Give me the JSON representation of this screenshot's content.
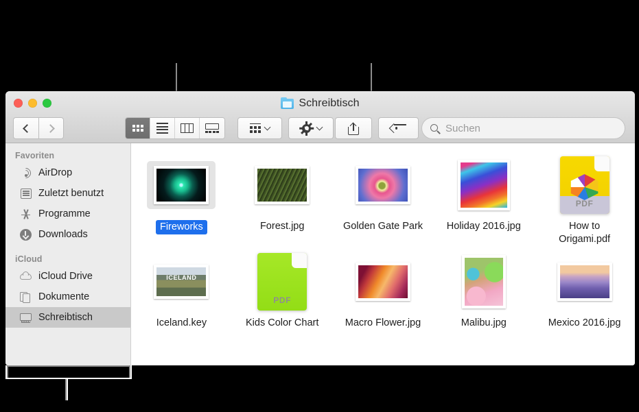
{
  "window": {
    "title": "Schreibtisch",
    "title_icon": "folder-icon",
    "traffic_lights": [
      "close-button",
      "minimize-button",
      "zoom-button"
    ]
  },
  "toolbar": {
    "back_label": "",
    "forward_label": "",
    "back_icon": "chevron-left-icon",
    "forward_icon": "chevron-right-icon",
    "view_buttons": [
      {
        "name": "icon-view",
        "icon": "grid-icon",
        "active": true
      },
      {
        "name": "list-view",
        "icon": "list-icon",
        "active": false
      },
      {
        "name": "column-view",
        "icon": "columns-icon",
        "active": false
      },
      {
        "name": "gallery-view",
        "icon": "gallery-icon",
        "active": false
      }
    ],
    "arrange_button": {
      "name": "arrange-by",
      "icon": "arrange-icon",
      "chevron": "chevron-down-icon"
    },
    "action_button": {
      "name": "action-menu",
      "icon": "gear-icon",
      "chevron": "chevron-down-icon"
    },
    "share_button": {
      "name": "share",
      "icon": "share-icon"
    },
    "tags_button": {
      "name": "tags",
      "icon": "tag-icon"
    }
  },
  "search": {
    "placeholder": "Suchen",
    "value": "",
    "icon": "search-icon"
  },
  "sidebar": {
    "sections": [
      {
        "heading": "Favoriten",
        "items": [
          {
            "label": "AirDrop",
            "icon": "airdrop-icon",
            "selected": false
          },
          {
            "label": "Zuletzt benutzt",
            "icon": "recents-icon",
            "selected": false
          },
          {
            "label": "Programme",
            "icon": "applications-icon",
            "selected": false
          },
          {
            "label": "Downloads",
            "icon": "downloads-icon",
            "selected": false
          }
        ]
      },
      {
        "heading": "iCloud",
        "items": [
          {
            "label": "iCloud Drive",
            "icon": "icloud-icon",
            "selected": false
          },
          {
            "label": "Dokumente",
            "icon": "documents-icon",
            "selected": false
          },
          {
            "label": "Schreibtisch",
            "icon": "desktop-icon",
            "selected": true
          }
        ]
      }
    ]
  },
  "files": [
    {
      "label": "Fireworks",
      "kind": "image",
      "selected": true,
      "orientation": "landscape"
    },
    {
      "label": "Forest.jpg",
      "kind": "image",
      "selected": false,
      "orientation": "landscape"
    },
    {
      "label": "Golden Gate Park",
      "kind": "image",
      "selected": false,
      "orientation": "landscape"
    },
    {
      "label": "Holiday 2016.jpg",
      "kind": "image",
      "selected": false,
      "orientation": "portrait"
    },
    {
      "label": "How to Origami.pdf",
      "kind": "pdf",
      "selected": false,
      "badge": "PDF",
      "color": "#f5d800"
    },
    {
      "label": "Iceland.key",
      "kind": "image",
      "selected": false,
      "orientation": "landscape"
    },
    {
      "label": "Kids Color Chart",
      "kind": "pdf",
      "selected": false,
      "badge": "PDF",
      "color": "#9ee122"
    },
    {
      "label": "Macro Flower.jpg",
      "kind": "image",
      "selected": false,
      "orientation": "landscape"
    },
    {
      "label": "Malibu.jpg",
      "kind": "image",
      "selected": false,
      "orientation": "portrait"
    },
    {
      "label": "Mexico 2016.jpg",
      "kind": "image",
      "selected": false,
      "orientation": "landscape"
    }
  ],
  "callouts": [
    {
      "name": "callout-view-buttons",
      "target": "view-button-group"
    },
    {
      "name": "callout-share-tags",
      "target": "share-and-tags-buttons"
    },
    {
      "name": "callout-sidebar",
      "target": "sidebar"
    }
  ],
  "colors": {
    "selection_blue": "#1e6fec",
    "sidebar_bg": "#ececec",
    "toolbar_bg": "#d8d8d8",
    "callout_line": "#8c8c8c",
    "background": "#000000"
  }
}
